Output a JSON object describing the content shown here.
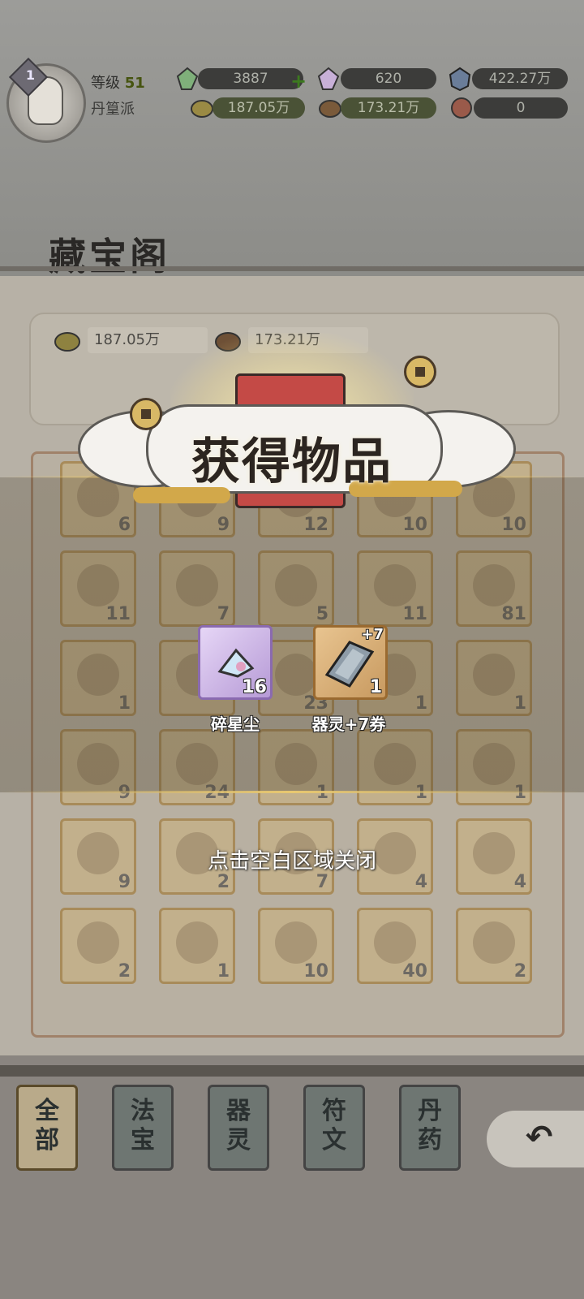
{
  "player": {
    "vip_level": "1",
    "level_label": "等级",
    "level_value": "51",
    "sect": "丹篁派"
  },
  "resources": {
    "top_left": "3887",
    "top_mid": "620",
    "top_right": "422.27万",
    "bottom_left": "187.05万",
    "bottom_mid": "173.21万",
    "bottom_right": "0"
  },
  "page": {
    "title": "藏宝阁",
    "coin_a": "187.05万",
    "coin_b": "173.21万"
  },
  "inventory": [
    {
      "count": "6"
    },
    {
      "count": "9"
    },
    {
      "count": "12"
    },
    {
      "count": "10"
    },
    {
      "count": "10"
    },
    {
      "count": "11"
    },
    {
      "count": "7"
    },
    {
      "count": "5"
    },
    {
      "count": "11"
    },
    {
      "count": "81"
    },
    {
      "count": "1"
    },
    {
      "count": ""
    },
    {
      "count": "23"
    },
    {
      "count": "1"
    },
    {
      "count": "1"
    },
    {
      "count": "9"
    },
    {
      "count": "24"
    },
    {
      "count": "1"
    },
    {
      "count": "1"
    },
    {
      "count": "1"
    },
    {
      "count": "9"
    },
    {
      "count": "2"
    },
    {
      "count": "7"
    },
    {
      "count": "4"
    },
    {
      "count": "4"
    },
    {
      "count": "2"
    },
    {
      "count": "1"
    },
    {
      "count": "10"
    },
    {
      "count": "40"
    },
    {
      "count": "2"
    }
  ],
  "popup": {
    "title": "获得物品",
    "items": [
      {
        "name": "碎星尘",
        "qty": "16"
      },
      {
        "name": "器灵+7券",
        "qty": "1",
        "badge": "+7"
      }
    ],
    "close_hint": "点击空白区域关闭"
  },
  "tabs": [
    {
      "label": "全部",
      "active": true
    },
    {
      "label": "法宝",
      "active": false
    },
    {
      "label": "器灵",
      "active": false
    },
    {
      "label": "符文",
      "active": false
    },
    {
      "label": "丹药",
      "active": false
    }
  ],
  "icons": {
    "back": "back-arrow-icon"
  }
}
